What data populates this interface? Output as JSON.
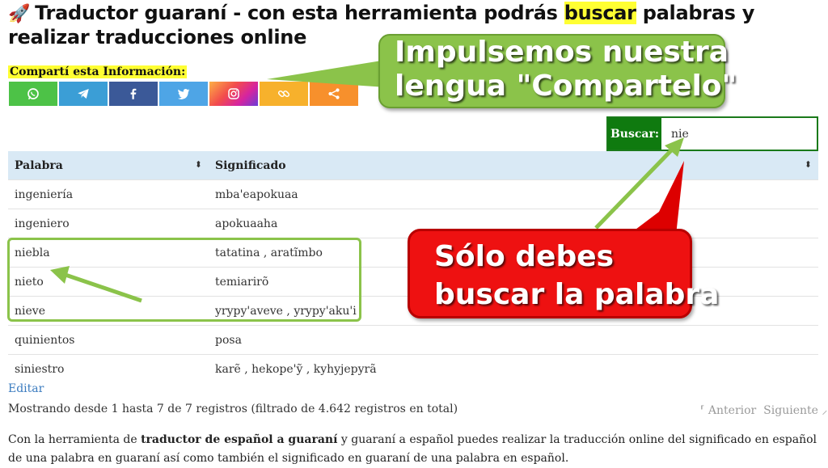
{
  "header": {
    "rocket_icon": "🚀",
    "title_before": "Traductor guaraní - con esta herramienta podrás ",
    "title_highlight": "buscar",
    "title_after": " palabras y realizar traducciones online"
  },
  "share": {
    "label": "Compartí esta Información:",
    "buttons": [
      {
        "name": "whatsapp",
        "icon": "whatsapp-icon",
        "color": "#4dc247"
      },
      {
        "name": "telegram",
        "icon": "telegram-icon",
        "color": "#3b9ed6"
      },
      {
        "name": "facebook",
        "icon": "facebook-icon",
        "color": "#3b5998"
      },
      {
        "name": "twitter",
        "icon": "twitter-icon",
        "color": "#4ea5e6"
      },
      {
        "name": "instagram",
        "icon": "instagram-icon",
        "color": "#d6249f"
      },
      {
        "name": "copy-link",
        "icon": "link-icon",
        "color": "#f7b12c"
      },
      {
        "name": "share",
        "icon": "share-icon",
        "color": "#f7902c"
      }
    ]
  },
  "callouts": {
    "green_line1": "Impulsemos nuestra",
    "green_line2": "lengua \"Compartelo\"",
    "red_line1": "Sólo debes",
    "red_line2": "buscar la palabra"
  },
  "search": {
    "label": "Buscar:",
    "value": "nie"
  },
  "table": {
    "columns": [
      "Palabra",
      "Significado"
    ],
    "sort_icon": "⬍",
    "rows": [
      {
        "palabra": "ingeniería",
        "significado": "mba'eapokuaa"
      },
      {
        "palabra": "ingeniero",
        "significado": "apokuaaha"
      },
      {
        "palabra": "niebla",
        "significado": "tatatina , aratĩmbo"
      },
      {
        "palabra": "nieto",
        "significado": "temiarirõ"
      },
      {
        "palabra": "nieve",
        "significado": "yrypy'aveve , yrypy'aku'i"
      },
      {
        "palabra": "quinientos",
        "significado": "posa"
      },
      {
        "palabra": "siniestro",
        "significado": "karẽ , hekope'ỹ , kyhyjepyrã"
      }
    ]
  },
  "edit_label": "Editar",
  "info": "Mostrando desde 1 hasta 7 de 7 registros (filtrado de 4.642 registros en total)",
  "pager": {
    "prev": "Anterior",
    "next": "Siguiente"
  },
  "description": {
    "part1": "Con la herramienta de ",
    "bold": "traductor de español a guaraní",
    "part2": " y guaraní a español puedes realizar la traducción online del significado en español de una palabra en guaraní así como también el significado en guaraní de una palabra en español."
  },
  "colors": {
    "highlight": "#ffff33",
    "table_header": "#d9e9f5",
    "search_green": "#0f7a0f",
    "callout_green": "#8bc34a",
    "callout_red": "#ee1111",
    "link": "#3a7bbf"
  }
}
